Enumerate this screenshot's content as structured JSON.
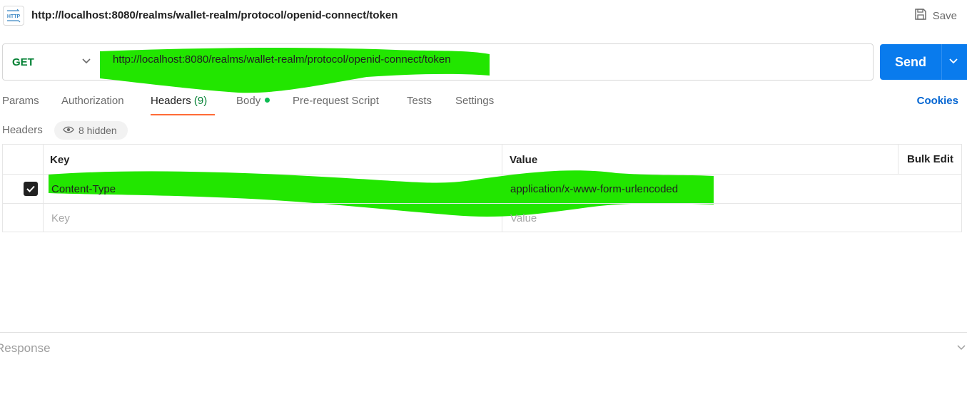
{
  "titlebar": {
    "icon": "http-file-icon",
    "icon_text": "HTTP",
    "title": "http://localhost:8080/realms/wallet-realm/protocol/openid-connect/token",
    "save_label": "Save"
  },
  "request": {
    "method": "GET",
    "url": "http://localhost:8080/realms/wallet-realm/protocol/openid-connect/token",
    "send_label": "Send"
  },
  "tabs": [
    {
      "label": "Params",
      "active": false
    },
    {
      "label": "Authorization",
      "active": false
    },
    {
      "label": "Headers",
      "count": "(9)",
      "active": true
    },
    {
      "label": "Body",
      "has_dot": true,
      "active": false
    },
    {
      "label": "Pre-request Script",
      "active": false
    },
    {
      "label": "Tests",
      "active": false
    },
    {
      "label": "Settings",
      "active": false
    }
  ],
  "cookies_label": "Cookies",
  "headers": {
    "label": "Headers",
    "hidden_label": "8 hidden",
    "columns": {
      "key": "Key",
      "value": "Value",
      "bulk_edit": "Bulk Edit"
    },
    "rows": [
      {
        "checked": true,
        "key": "Content-Type",
        "value": "application/x-www-form-urlencoded"
      }
    ],
    "new_row": {
      "key_placeholder": "Key",
      "value_placeholder": "Value"
    }
  },
  "response": {
    "label": "Response"
  },
  "colors": {
    "method_green": "#007f31",
    "send_blue": "#097bed",
    "tab_underline": "#ff6c37",
    "cookies_link": "#0265d2",
    "redaction_green": "#22e600"
  }
}
